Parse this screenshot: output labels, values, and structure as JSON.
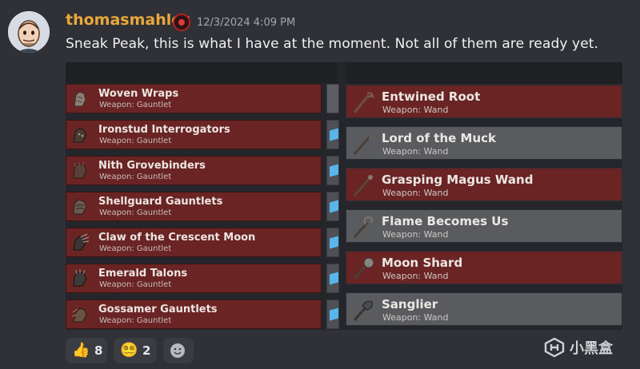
{
  "message": {
    "username": "thomasmahler",
    "timestamp": "12/3/2024 4:09 PM",
    "text": "Sneak Peak, this is what I have at the moment. Not all of them are ready yet."
  },
  "left_items": [
    {
      "name": "Woven Wraps",
      "type": "Weapon: Gauntlet"
    },
    {
      "name": "Ironstud Interrogators",
      "type": "Weapon: Gauntlet"
    },
    {
      "name": "Nith Grovebinders",
      "type": "Weapon: Gauntlet"
    },
    {
      "name": "Shellguard Gauntlets",
      "type": "Weapon: Gauntlet"
    },
    {
      "name": "Claw of the Crescent Moon",
      "type": "Weapon: Gauntlet"
    },
    {
      "name": "Emerald Talons",
      "type": "Weapon: Gauntlet"
    },
    {
      "name": "Gossamer Gauntlets",
      "type": "Weapon: Gauntlet"
    }
  ],
  "right_items": [
    {
      "name": "Entwined Root",
      "type": "Weapon: Wand",
      "style": "red"
    },
    {
      "name": "Lord of the Muck",
      "type": "Weapon: Wand",
      "style": "gray"
    },
    {
      "name": "Grasping Magus Wand",
      "type": "Weapon: Wand",
      "style": "red"
    },
    {
      "name": "Flame Becomes Us",
      "type": "Weapon: Wand",
      "style": "gray"
    },
    {
      "name": "Moon Shard",
      "type": "Weapon: Wand",
      "style": "red"
    },
    {
      "name": "Sanglier",
      "type": "Weapon: Wand",
      "style": "gray"
    }
  ],
  "reactions": [
    {
      "emoji": "👍",
      "count": "8"
    },
    {
      "emoji": "😵‍💫",
      "count": "2"
    }
  ],
  "add_reaction_icon": "smiley-icon",
  "watermark": {
    "text": "小黑盒"
  },
  "colors": {
    "username": "#e9a83b",
    "background": "#303136",
    "item_red": "#6a2424",
    "item_gray": "#5a5b5f"
  }
}
